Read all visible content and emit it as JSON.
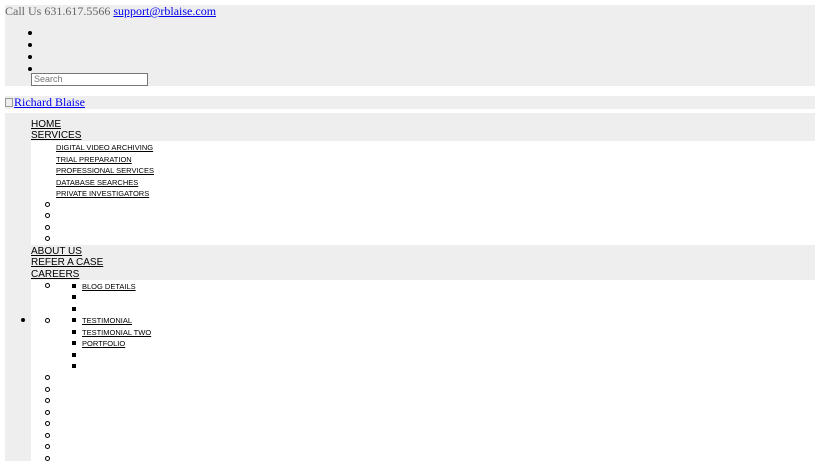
{
  "topbar": {
    "call_text": "Call Us 631.617.5566",
    "email": "support@rblaise.com",
    "search_placeholder": "Search"
  },
  "header": {
    "logo_alt": "Richard Blaise"
  },
  "nav": {
    "home": "HOME",
    "services": "SERVICES",
    "services_sub": [
      "DIGITAL VIDEO ARCHIVING",
      "TRIAL PREPARATION",
      "PROFESSIONAL SERVICES",
      "DATABASE SEARCHES",
      "PRIVATE INVESTIGATORS"
    ],
    "about": "ABOUT US",
    "refer": "REFER A CASE",
    "careers": "CAREERS",
    "careers_sub": {
      "blog": "BLOG DETAILS",
      "testimonial": "TESTIMONIAL",
      "testimonial_two": "TESTIMONIAL TWO",
      "portfolio": "PORTFOLIO"
    }
  }
}
